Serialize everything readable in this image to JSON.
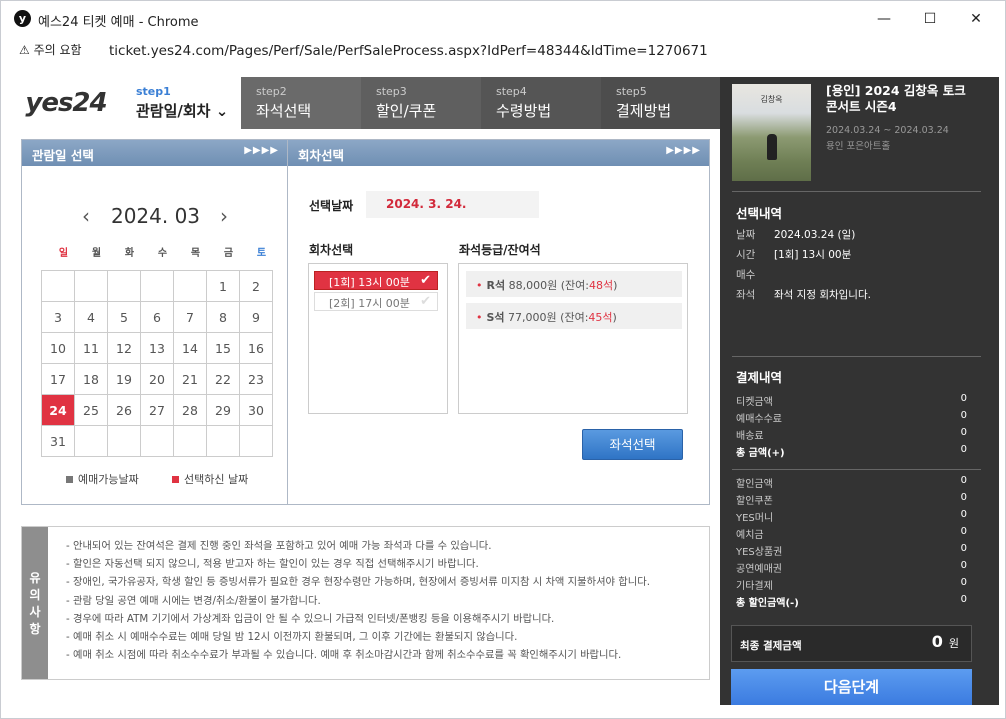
{
  "window": {
    "app_icon": "y",
    "title": "예스24 티켓 예매 - Chrome",
    "minimize": "—",
    "maximize": "☐",
    "close": "✕"
  },
  "address": {
    "security_warning": "⚠ 주의 요함",
    "url": "ticket.yes24.com/Pages/Perf/Sale/PerfSaleProcess.aspx?IdPerf=48344&IdTime=1270671"
  },
  "header": {
    "logo": "yes24",
    "steps": [
      {
        "step": "step1",
        "name": "관람일/회차 ⌄"
      },
      {
        "step": "step2",
        "name": "좌석선택"
      },
      {
        "step": "step3",
        "name": "할인/쿠폰"
      },
      {
        "step": "step4",
        "name": "수령방법"
      },
      {
        "step": "step5",
        "name": "결제방법"
      }
    ]
  },
  "date_panel": {
    "title": "관람일 선택",
    "arrows": "▶▶▶▶",
    "month": "2024. 03",
    "prev": "‹",
    "next": "›",
    "dow": [
      "일",
      "월",
      "화",
      "수",
      "목",
      "금",
      "토"
    ],
    "weeks": [
      [
        "",
        "",
        "",
        "",
        "",
        "1",
        "2"
      ],
      [
        "3",
        "4",
        "5",
        "6",
        "7",
        "8",
        "9"
      ],
      [
        "10",
        "11",
        "12",
        "13",
        "14",
        "15",
        "16"
      ],
      [
        "17",
        "18",
        "19",
        "20",
        "21",
        "22",
        "23"
      ],
      [
        "24",
        "25",
        "26",
        "27",
        "28",
        "29",
        "30"
      ],
      [
        "31",
        "",
        "",
        "",
        "",
        "",
        ""
      ]
    ],
    "selected_day": "24",
    "legend_available": "예매가능날짜",
    "legend_selected": "선택하신 날짜"
  },
  "round_panel": {
    "title": "회차선택",
    "arrows": "▶▶▶▶",
    "selected_date_label": "선택날짜",
    "selected_date": "2024. 3. 24.",
    "round_label": "회차선택",
    "rounds": [
      {
        "label": "[1회] 13시 00분",
        "check": "✔"
      },
      {
        "label": "[2회] 17시 00분",
        "check": "✔"
      }
    ],
    "seat_label": "좌석등급/잔여석",
    "seats": [
      {
        "grade": "R석",
        "price": "88,000원",
        "remain_prefix": "(잔여:",
        "remain": "48석",
        "remain_suffix": ")"
      },
      {
        "grade": "S석",
        "price": "77,000원",
        "remain_prefix": "(잔여:",
        "remain": "45석",
        "remain_suffix": ")"
      }
    ],
    "seat_button": "좌석선택"
  },
  "notice": {
    "side_label": [
      "유",
      "의",
      "사",
      "항"
    ],
    "items": [
      "- 안내되어 있는 잔여석은 결제 진행 중인 좌석을 포함하고 있어 예매 가능 좌석과 다를 수 있습니다.",
      "- 할인은 자동선택 되지 않으니, 적용 받고자 하는 할인이 있는 경우 직접 선택해주시기 바랍니다.",
      "- 장애인, 국가유공자, 학생 할인 등 증빙서류가 필요한 경우 현장수령만 가능하며, 현장에서 증빙서류 미지참 시 차액 지불하셔야 합니다.",
      "- 관람 당일 공연 예매 시에는 변경/취소/환불이 불가합니다.",
      "- 경우에 따라 ATM 기기에서 가상계좌 입금이 안 될 수 있으니 가급적 인터넷/폰뱅킹 등을 이용해주시기 바랍니다.",
      "- 예매 취소 시 예매수수료는 예매 당일 밤 12시 이전까지 환불되며, 그 이후 기간에는 환불되지 않습니다.",
      "- 예매 취소 시점에 따라 취소수수료가 부과될 수 있습니다. 예매 후 취소마감시간과 함께 취소수수료를 꼭 확인해주시기 바랍니다."
    ]
  },
  "sidebar": {
    "poster_text": "김창옥",
    "concert_title": "[용인] 2024 김창옥 토크콘서트 시즌4",
    "concert_dates": "2024.03.24 ~ 2024.03.24",
    "venue": "용인 포은아트홀",
    "selection_title": "선택내역",
    "selection": [
      {
        "k": "날짜",
        "v": "2024.03.24 (일)"
      },
      {
        "k": "시간",
        "v": "[1회] 13시 00분"
      },
      {
        "k": "매수",
        "v": ""
      },
      {
        "k": "좌석",
        "v": "좌석 지정 회차입니다."
      }
    ],
    "payment_title": "결제내역",
    "payment": [
      {
        "k": "티켓금액",
        "v": "0"
      },
      {
        "k": "예매수수료",
        "v": "0"
      },
      {
        "k": "배송료",
        "v": "0"
      },
      {
        "k": "총 금액(+)",
        "v": "0"
      }
    ],
    "discount": [
      {
        "k": "할인금액",
        "v": "0"
      },
      {
        "k": "할인쿠폰",
        "v": "0"
      },
      {
        "k": "YES머니",
        "v": "0"
      },
      {
        "k": "예치금",
        "v": "0"
      },
      {
        "k": "YES상품권",
        "v": "0"
      },
      {
        "k": "공연예매권",
        "v": "0"
      },
      {
        "k": "기타결제",
        "v": "0"
      },
      {
        "k": "총 할인금액(-)",
        "v": "0"
      }
    ],
    "final_label": "최종 결제금액",
    "final_value": "0",
    "final_unit": "원",
    "next_button": "다음단계"
  }
}
